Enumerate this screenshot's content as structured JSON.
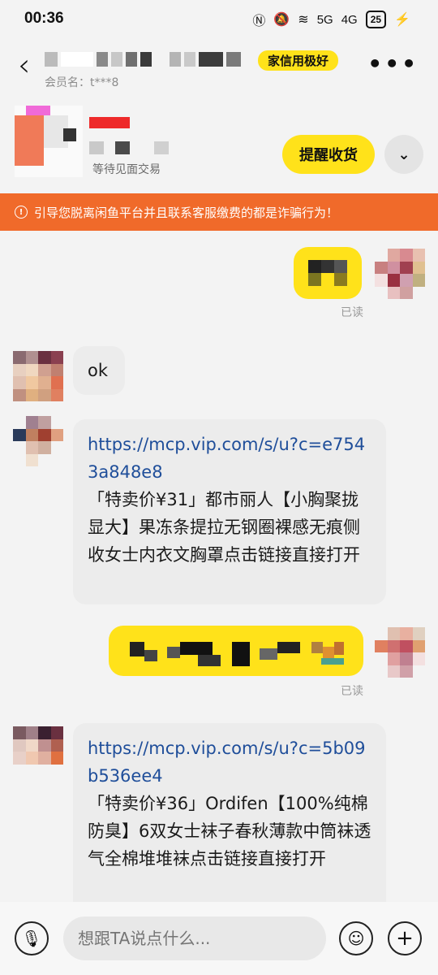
{
  "status_bar": {
    "time": "00:36",
    "network_5g": "5G",
    "network_4g": "4G",
    "battery": "25"
  },
  "header": {
    "badge": "家信用极好",
    "member_label": "会员名：t***8",
    "trade_status": "等待见面交易",
    "remind_button": "提醒收货"
  },
  "warning": {
    "text": "引导您脱离闲鱼平台并且联系客服缴费的都是诈骗行为！"
  },
  "messages": [
    {
      "read": "已读"
    },
    {
      "text": "ok"
    },
    {
      "link": "https://mcp.vip.com/s/u?c=e7543a848e8",
      "text": "「特卖价¥31」都市丽人【小胸聚拢显大】果冻条提拉无钢圈裸感无痕侧收女士内衣文胸罩点击链接直接打开"
    },
    {
      "read": "已读"
    },
    {
      "link": "https://mcp.vip.com/s/u?c=5b09b536ee4",
      "text": "「特卖价¥36」Ordifen【100%纯棉防臭】6双女士袜子春秋薄款中筒袜透气全棉堆堆袜点击链接直接打开"
    }
  ],
  "input": {
    "placeholder": "想跟TA说点什么..."
  },
  "icons": [
    "back-icon",
    "more-icon",
    "chevron-down-icon",
    "warning-icon",
    "mic-icon",
    "emoji-icon",
    "plus-icon"
  ],
  "colors": {
    "accent": "#ffe21a",
    "warning": "#f06a2a",
    "link": "#1f4e9a"
  }
}
